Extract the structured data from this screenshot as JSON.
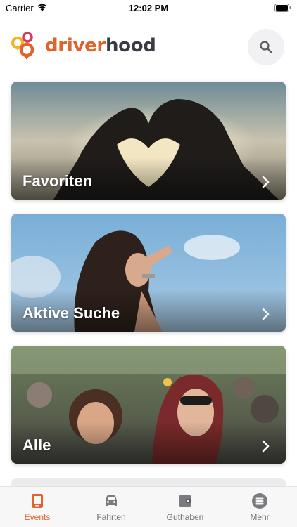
{
  "status_bar": {
    "carrier": "Carrier",
    "time": "12:02 PM"
  },
  "header": {
    "logo_part1": "driver",
    "logo_part2": "hood"
  },
  "cards": [
    {
      "label": "Favoriten"
    },
    {
      "label": "Aktive Suche"
    },
    {
      "label": "Alle"
    }
  ],
  "tabs": [
    {
      "label": "Events",
      "icon": "tablet-icon",
      "active": true
    },
    {
      "label": "Fahrten",
      "icon": "car-icon"
    },
    {
      "label": "Guthaben",
      "icon": "wallet-icon"
    },
    {
      "label": "Mehr",
      "icon": "menu-icon"
    }
  ],
  "colors": {
    "accent": "#e0632c",
    "dark": "#3b3b43",
    "tab_inactive": "#6f6f74"
  }
}
